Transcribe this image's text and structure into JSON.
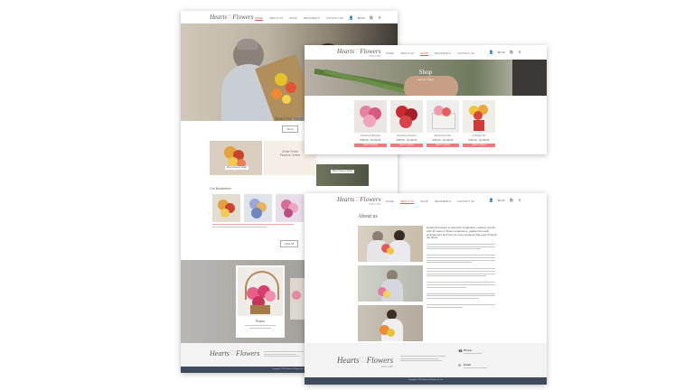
{
  "brand": {
    "name_a": "Hearts",
    "name_b": "Flowers",
    "tagline": "FOR LIFE"
  },
  "nav": [
    "HOME",
    "ABOUT US",
    "SHOP",
    "RECIPIENTS",
    "CONTACT US"
  ],
  "nav_shop": [
    "HOME",
    "ABOUT US",
    "SHOP",
    "RECIPIENTS",
    "CONTACT US"
  ],
  "cart": {
    "amount": "$0.00",
    "count": "0"
  },
  "home": {
    "story_heading": "Read Our Story",
    "story_button": "Shop",
    "card_button": "Shop Flowers Today",
    "tagline_block": "Order Fresh Flowers Online",
    "bestsellers": "Our Bestsellers",
    "view_more": "View All",
    "feature_title": "Roses",
    "copyright": "Copyright © 2022 Hearts & Flowers for Life"
  },
  "shop": {
    "banner_title": "Shop",
    "banner_sub": "Home / Shop",
    "products": [
      {
        "name": "Pink Roses Bouquet",
        "price": "R350.00 – R1,200.00",
        "button": "Select options"
      },
      {
        "name": "Red Roses Bouquet",
        "price": "R350.00 – R1,000.00",
        "button": "Select options"
      },
      {
        "name": "Mixed Flower Box",
        "price": "R450.00 – R1,250.00",
        "button": "Select options"
      },
      {
        "name": "Sunflower Pot",
        "price": "R400.00 – R1,350.00",
        "button": "Select options"
      }
    ]
  },
  "about": {
    "heading": "About us",
    "intro": "Hearts & Flowers is owned by a talented, creative woman with 40 years of flower experience, passion for each arrangement and love for every bouquet that goes through the florist."
  },
  "footer": {
    "phone_label": "Phone",
    "email_label": "Email"
  },
  "colors": {
    "accent": "#e15b5b",
    "button": "#f07a7a",
    "footer_bar": "#3f4a5c"
  }
}
